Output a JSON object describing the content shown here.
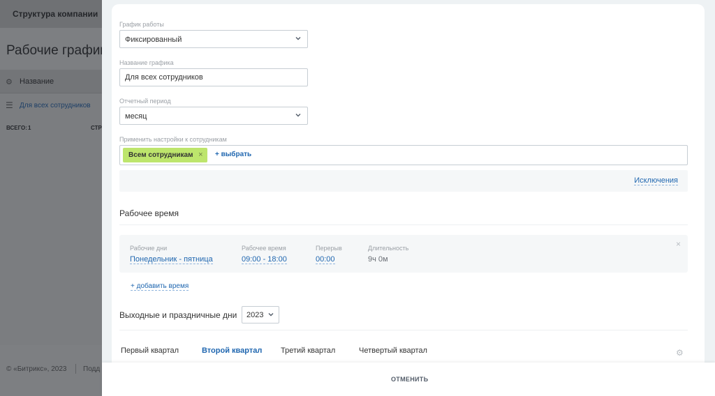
{
  "background": {
    "topbar_title": "Структура компании",
    "page_heading": "Рабочие график",
    "table": {
      "header": "Название",
      "row": "Для всех сотрудников",
      "total_label": "ВСЕГО:",
      "total_value": "1",
      "column_fragment": "СТР"
    },
    "footer": {
      "copyright": "© «Битрикс», 2023",
      "fragment": "Подд"
    }
  },
  "form": {
    "schedule_type": {
      "label": "График работы",
      "value": "Фиксированный"
    },
    "schedule_name": {
      "label": "Название графика",
      "value": "Для всех сотрудников"
    },
    "report_period": {
      "label": "Отчетный период",
      "value": "месяц"
    },
    "apply_to": {
      "label": "Применить настройки к сотрудникам",
      "tag": "Всем сотрудникам",
      "tag_remove": "×",
      "choose_link": "+ выбрать"
    },
    "exceptions_link": "Исключения"
  },
  "work_time": {
    "title": "Рабочее время",
    "days_label": "Рабочие дни",
    "days_value": "Понедельник - пятница",
    "hours_label": "Рабочее время",
    "hours_value": "09:00 - 18:00",
    "break_label": "Перерыв",
    "break_value": "00:00",
    "duration_label": "Длительность",
    "duration_value": "9ч 0м",
    "remove": "×",
    "add_time": "+ добавить время"
  },
  "holidays": {
    "title": "Выходные и праздничные дни",
    "year": "2023",
    "quarters": [
      "Первый квартал",
      "Второй квартал",
      "Третий квартал",
      "Четвертый квартал"
    ],
    "active_quarter_index": 1
  },
  "footer_bar": {
    "cancel": "ОТМЕНИТЬ"
  },
  "colors": {
    "accent_link": "#2067b0",
    "tag_background": "#bde56c",
    "overlay": "#7d7f82"
  },
  "icons": [
    "gear-icon",
    "menu-icon",
    "chevron-down-icon",
    "close-icon",
    "settings-gear-icon"
  ]
}
